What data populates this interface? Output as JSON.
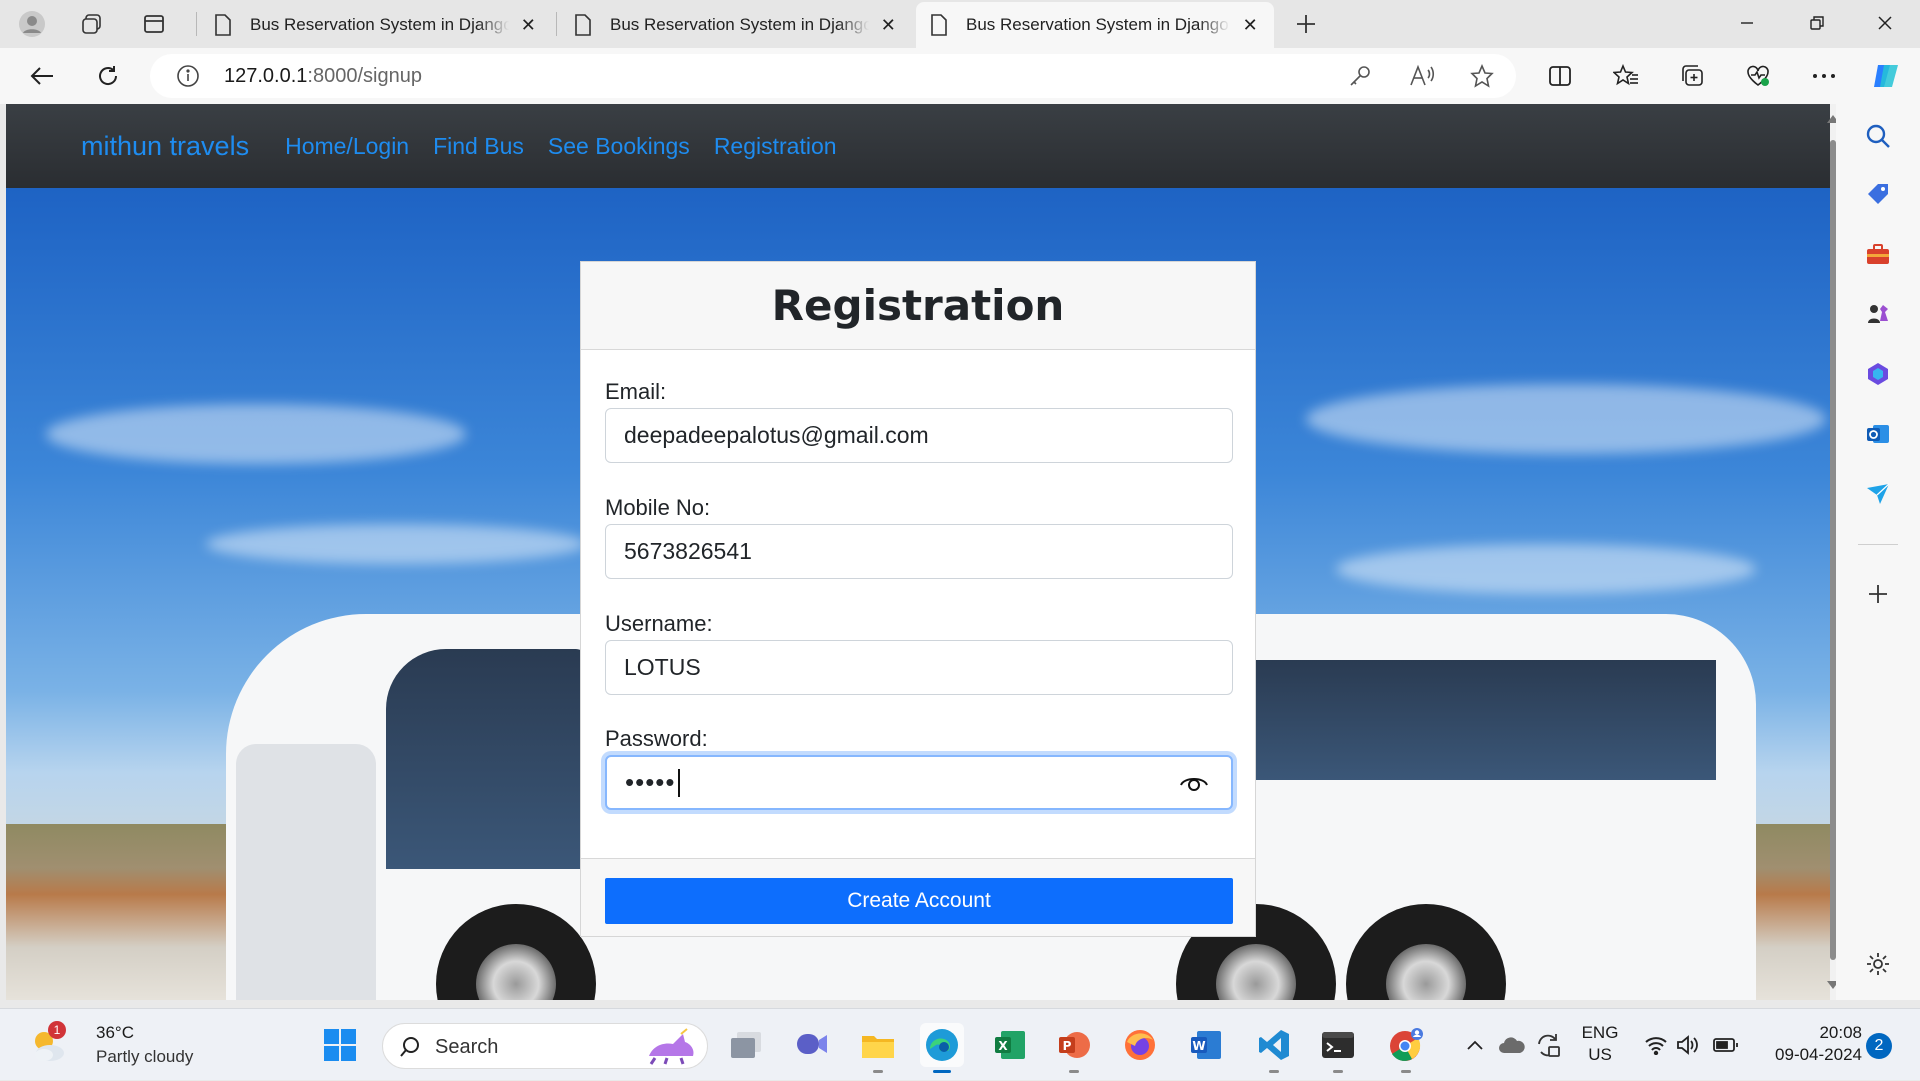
{
  "browser": {
    "tabs": [
      {
        "title": "Bus Reservation System in Django"
      },
      {
        "title": "Bus Reservation System in Django"
      },
      {
        "title": "Bus Reservation System in Django"
      }
    ],
    "active_tab": 2,
    "url_host": "127.0.0.1",
    "url_path": ":8000/signup"
  },
  "navbar": {
    "brand": "mithun travels",
    "links": [
      "Home/Login",
      "Find Bus",
      "See Bookings",
      "Registration"
    ]
  },
  "form": {
    "title": "Registration",
    "email_label": "Email:",
    "email_value": "deepadeepalotus@gmail.com",
    "mobile_label": "Mobile No:",
    "mobile_value": "5673826541",
    "username_label": "Username:",
    "username_value": "LOTUS",
    "password_label": "Password:",
    "password_masked": "•••••",
    "submit_label": "Create Account"
  },
  "taskbar": {
    "weather_temp": "36°C",
    "weather_desc": "Partly cloudy",
    "weather_badge": "1",
    "search_label": "Search",
    "lang_top": "ENG",
    "lang_bottom": "US",
    "time": "20:08",
    "date": "09-04-2024",
    "notification_count": "2"
  },
  "colors": {
    "accent": "#0d6efd",
    "navbar_link": "#1e8cf0",
    "navbar_bg": "#2f3337"
  }
}
